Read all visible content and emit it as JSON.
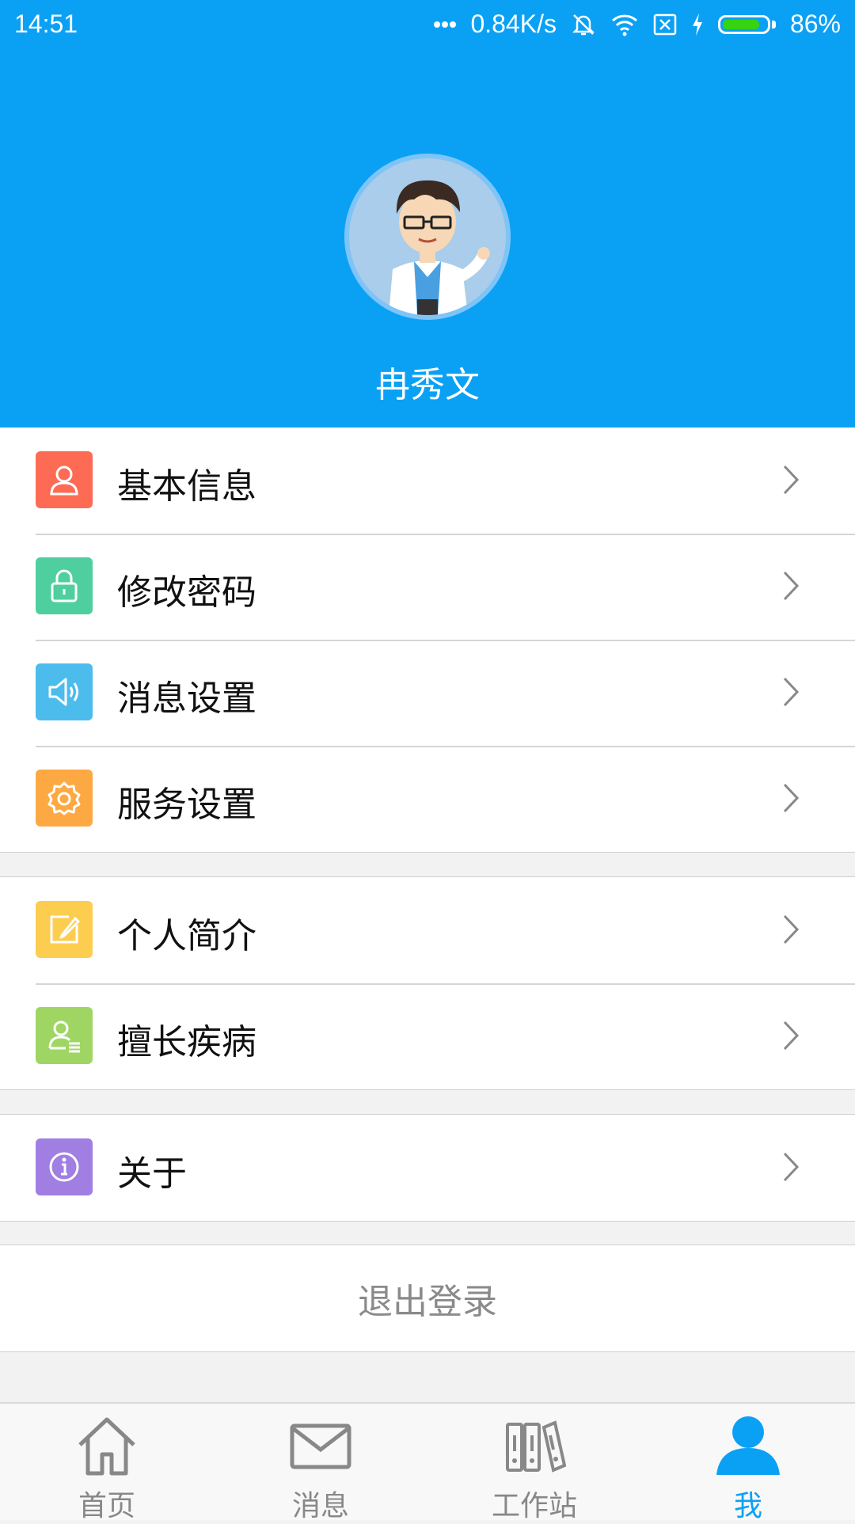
{
  "status_bar": {
    "time": "14:51",
    "network_speed": "0.84K/s",
    "battery_percent": "86%",
    "battery_level": 0.86,
    "icons": [
      "more-dots-icon",
      "mute-bell-icon",
      "wifi-icon",
      "no-sim-icon",
      "charging-icon",
      "battery-icon"
    ]
  },
  "profile": {
    "name": "冉秀文",
    "avatar": "doctor-avatar"
  },
  "menu": {
    "basic_info": {
      "label": "基本信息",
      "icon": "person-icon",
      "color": "#fd6b55"
    },
    "change_password": {
      "label": "修改密码",
      "icon": "lock-icon",
      "color": "#4fcf9f"
    },
    "message_settings": {
      "label": "消息设置",
      "icon": "speaker-icon",
      "color": "#4cbcec"
    },
    "service_settings": {
      "label": "服务设置",
      "icon": "gear-icon",
      "color": "#fda943"
    },
    "personal_intro": {
      "label": "个人简介",
      "icon": "edit-icon",
      "color": "#fdcd4f"
    },
    "specialty": {
      "label": "擅长疾病",
      "icon": "person-list-icon",
      "color": "#9fd663"
    },
    "about": {
      "label": "关于",
      "icon": "info-icon",
      "color": "#a07ee2"
    }
  },
  "logout_label": "退出登录",
  "tabs": [
    {
      "label": "首页",
      "icon": "home-icon",
      "active": false
    },
    {
      "label": "消息",
      "icon": "mail-icon",
      "active": false
    },
    {
      "label": "工作站",
      "icon": "folders-icon",
      "active": false
    },
    {
      "label": "我",
      "icon": "user-icon",
      "active": true
    }
  ],
  "colors": {
    "primary": "#0aa1f5",
    "background": "#f2f2f2"
  }
}
